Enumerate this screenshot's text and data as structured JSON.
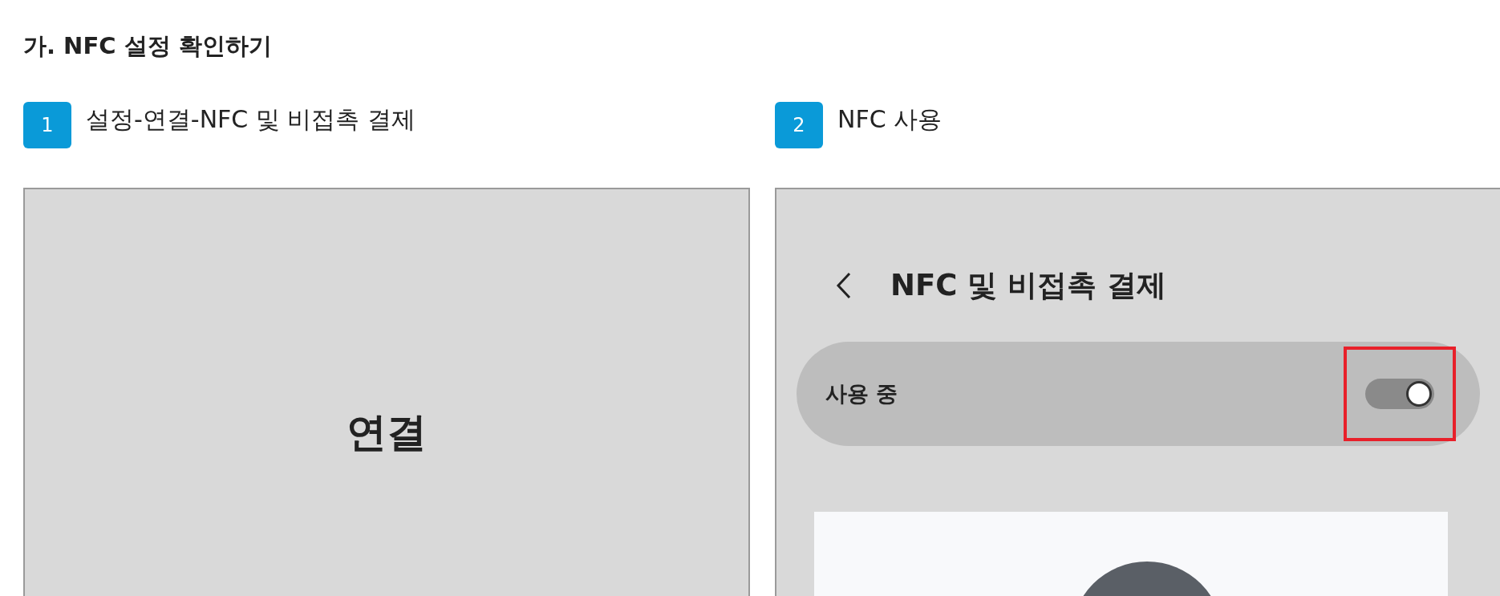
{
  "heading": "가. NFC 설정 확인하기",
  "steps": [
    {
      "number": "1",
      "label": "설정-연결-NFC 및 비접촉 결제",
      "screen": {
        "kind": "menu",
        "title": "연결"
      }
    },
    {
      "number": "2",
      "label": "NFC 사용",
      "screen": {
        "kind": "settings",
        "title": "NFC 및 비접촉 결제",
        "toggle_label": "사용 중",
        "on": true,
        "highlighted": true
      }
    }
  ]
}
